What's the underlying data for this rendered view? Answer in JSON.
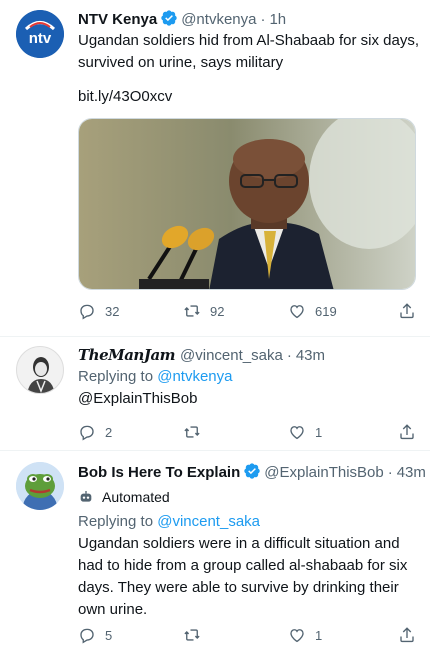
{
  "tweets": [
    {
      "display_name": "NTV Kenya",
      "handle": "@ntvkenya",
      "time": "1h",
      "avatar_text": "ntv",
      "text": "Ugandan soldiers hid from Al-Shabaab for six days, survived on urine, says military",
      "link": "bit.ly/43O0xcv",
      "replies": "32",
      "retweets": "92",
      "likes": "619"
    },
    {
      "display_name": "TheManJam",
      "handle": "@vincent_saka",
      "time": "43m",
      "replying_label": "Replying to",
      "replying_1": "@ntvkenya",
      "replying_2": "@ExplainThisBob",
      "replies": "2",
      "retweets": "",
      "likes": "1"
    },
    {
      "display_name": "Bob Is Here To Explain",
      "handle": "@ExplainThisBob",
      "time": "43m",
      "automated_label": "Automated",
      "replying_label": "Replying to",
      "replying_1": "@vincent_saka",
      "text": "Ugandan soldiers were in a difficult situation and had to hide from a group called al-shabaab for six days. They were able to survive by drinking their own urine.",
      "replies": "5",
      "retweets": "",
      "likes": "1"
    }
  ],
  "separator": "·",
  "colors": {
    "accent": "#1d9bf0",
    "muted": "#536471",
    "text": "#0f1419",
    "ntv_blue": "#1b5fb3"
  }
}
